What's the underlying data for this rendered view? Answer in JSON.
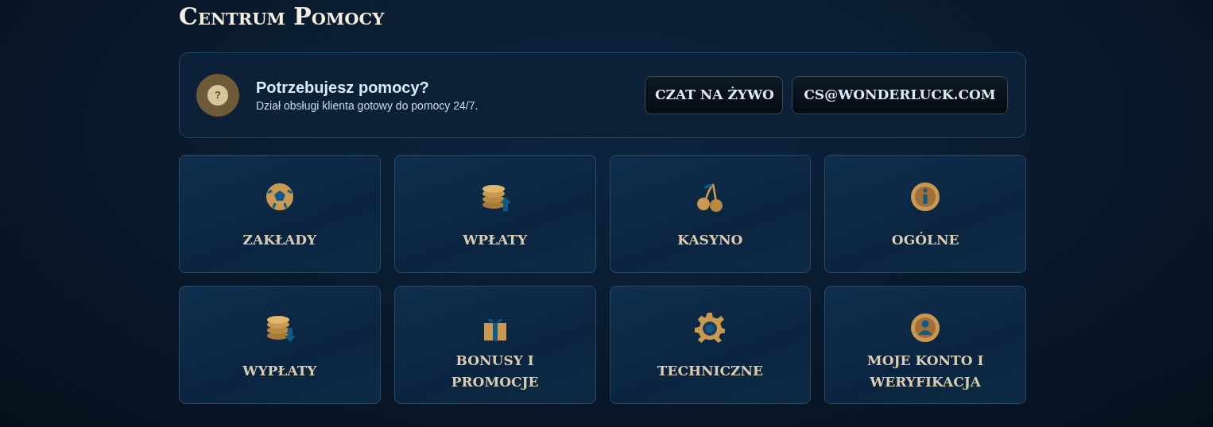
{
  "title": "Centrum Pomocy",
  "help": {
    "heading": "Potrzebujesz pomocy?",
    "text": "Dział obsługi klienta gotowy do pomocy 24/7.",
    "icon_text": "?",
    "buttons": [
      "CZAT NA ŻYWO",
      "CS@WONDERLUCK.COM"
    ]
  },
  "categories": [
    {
      "label": "ZAKŁADY",
      "kind": "ball"
    },
    {
      "label": "WPŁATY",
      "kind": "coins-up"
    },
    {
      "label": "KASYNO",
      "kind": "cherries"
    },
    {
      "label": "OGÓLNE",
      "kind": "info"
    },
    {
      "label": "WYPŁATY",
      "kind": "coins-down"
    },
    {
      "label": "BONUSY I PROMOCJE",
      "kind": "gift"
    },
    {
      "label": "TECHNICZNE",
      "kind": "gear"
    },
    {
      "label": "MOJE KONTO I WERYFIKACJA",
      "kind": "user"
    }
  ]
}
